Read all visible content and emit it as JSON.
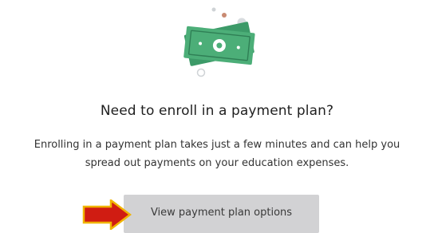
{
  "illustration": {
    "icon": "cash-stack-icon",
    "colors": {
      "bill_back": "#3c9a68",
      "bill_front": "#4cae78",
      "bill_line": "#2f7f55",
      "accent_dot": "#c98a72",
      "grey_dot": "#cfd3d6"
    }
  },
  "prompt": {
    "heading": "Need to enroll in a payment plan?",
    "description_line_1": "Enrolling in a payment plan takes just a few minutes and can help you",
    "description_line_2": "spread out payments on your education expenses."
  },
  "actions": {
    "view_options_label": "View payment plan options",
    "button_color": "#d2d2d4"
  },
  "annotation": {
    "icon": "right-arrow-icon",
    "fill": "#d01c12",
    "outline": "#f0b400"
  }
}
